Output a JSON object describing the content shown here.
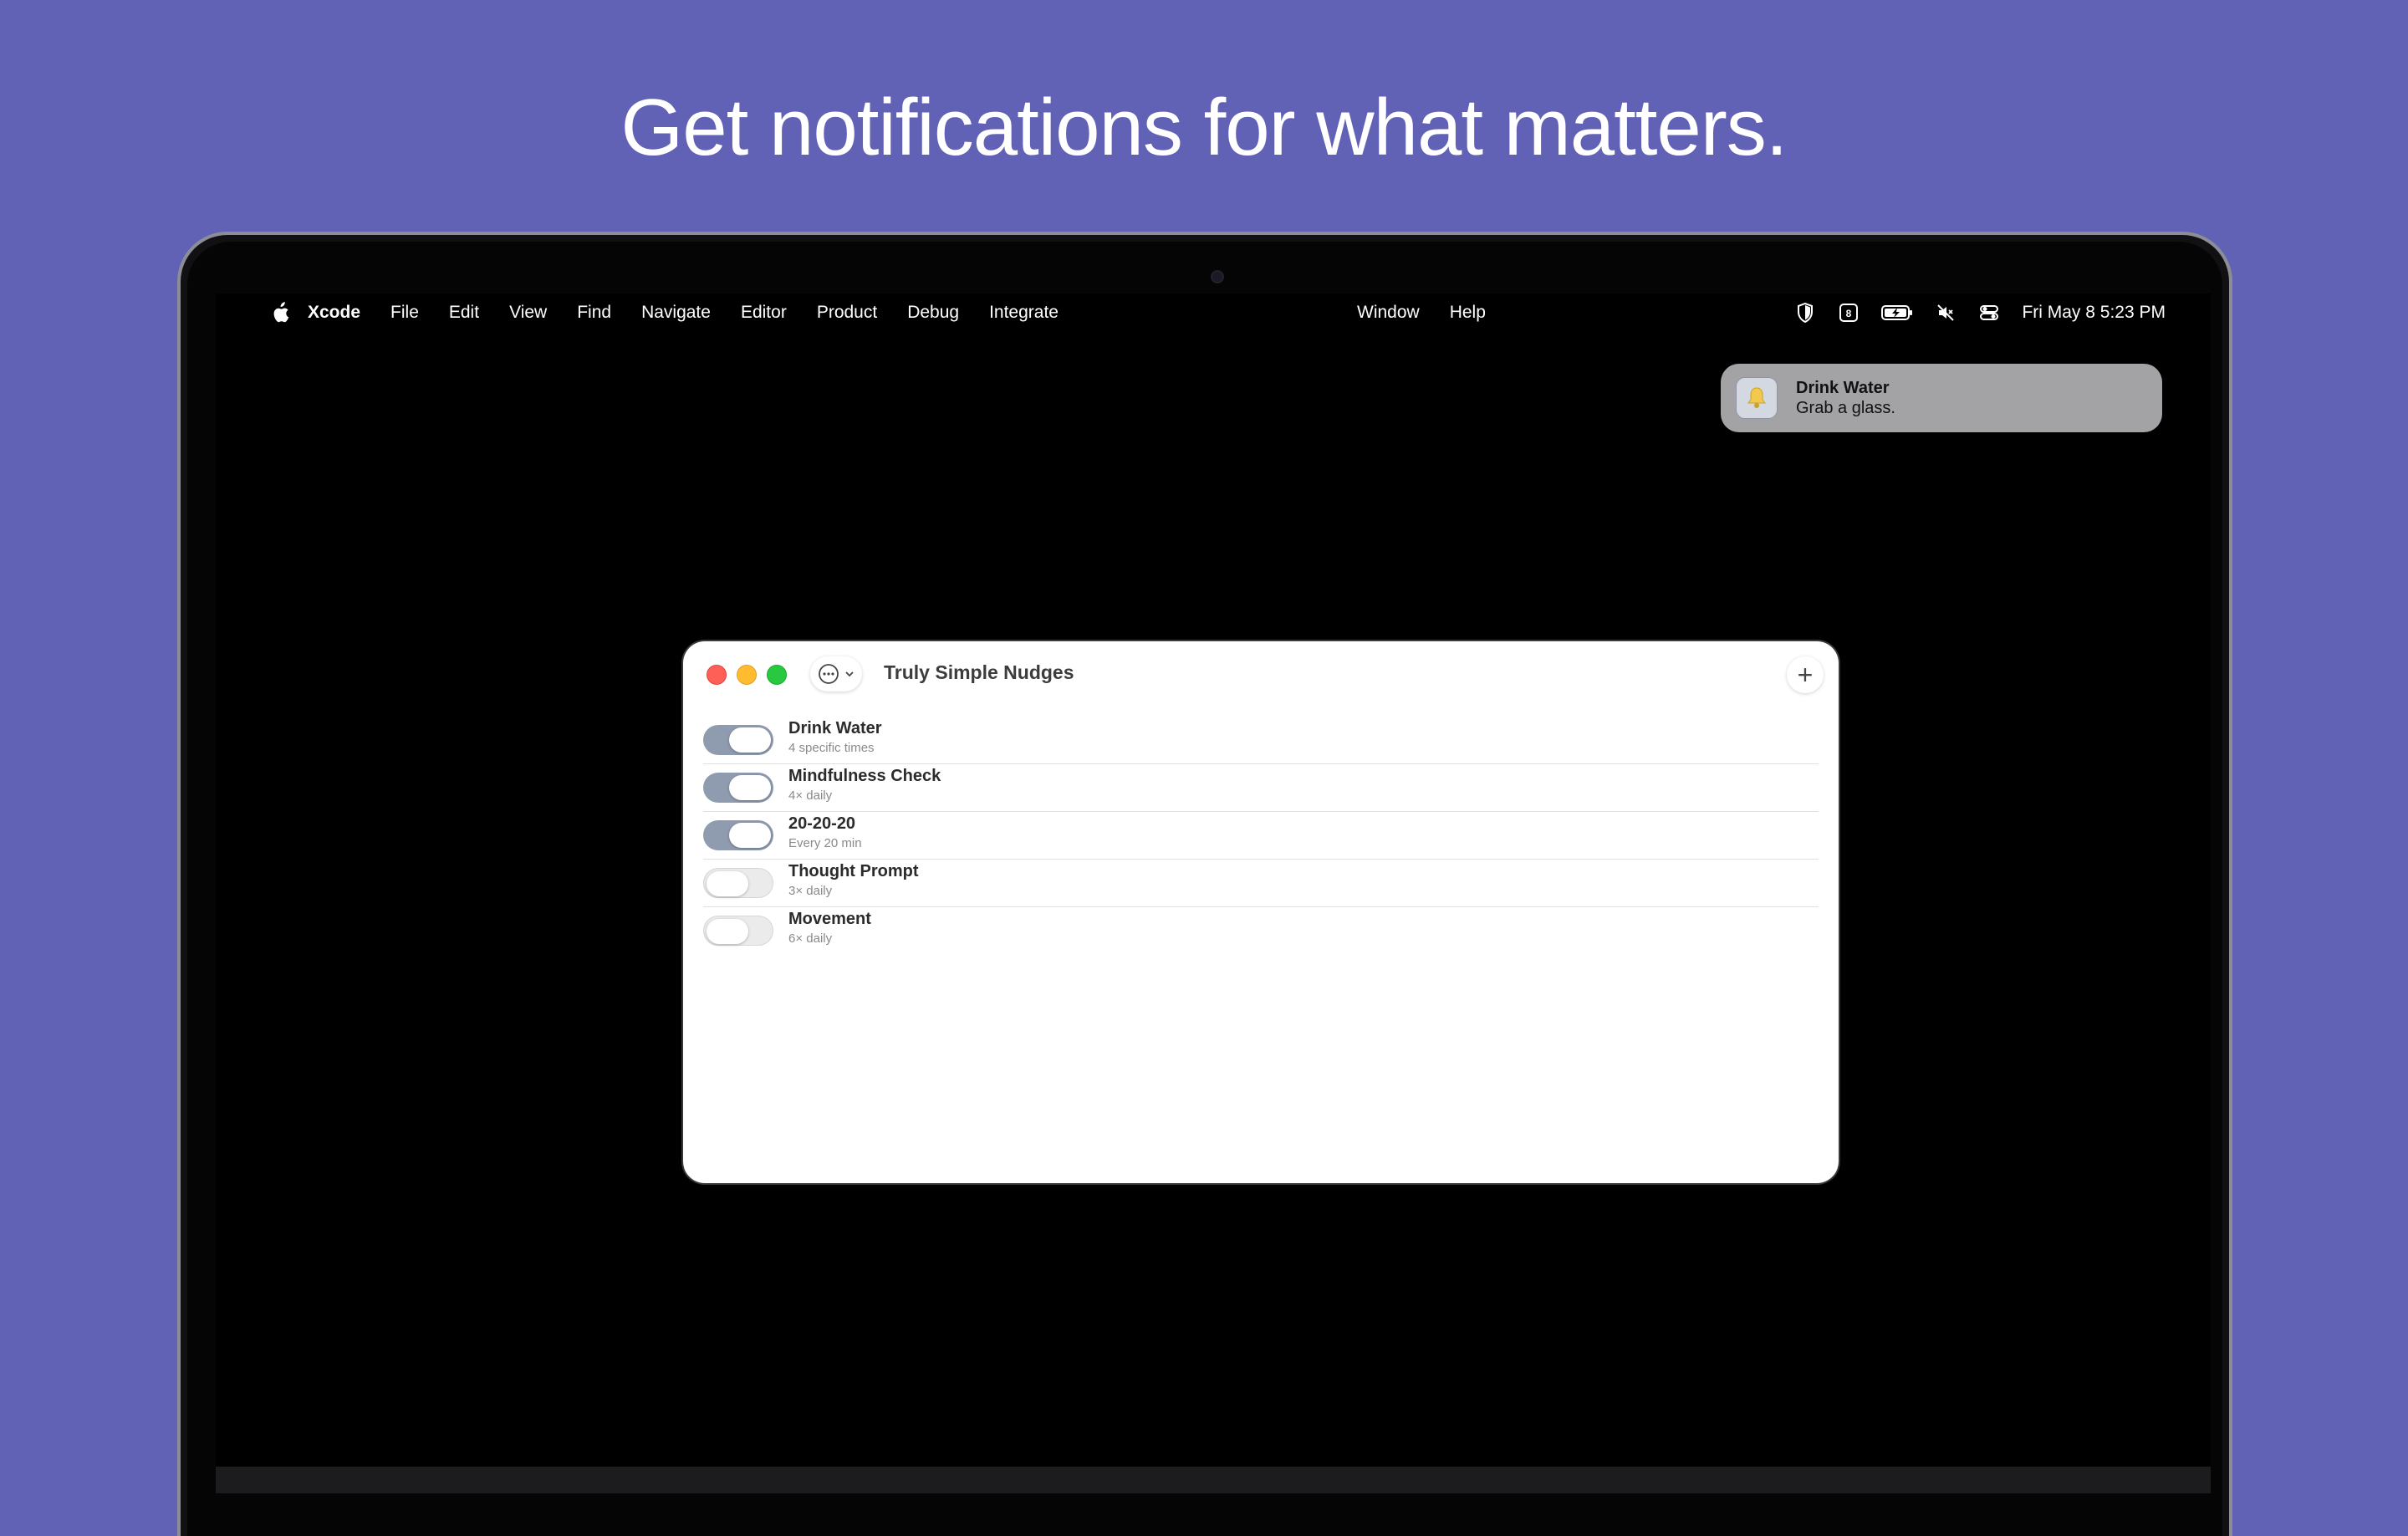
{
  "headline": "Get notifications for what matters.",
  "menubar": {
    "app_name": "Xcode",
    "items": [
      "File",
      "Edit",
      "View",
      "Find",
      "Navigate",
      "Editor",
      "Product",
      "Debug",
      "Integrate"
    ],
    "center_items": [
      "Window",
      "Help"
    ],
    "status_icons": [
      "shield-icon",
      "calendar-badge-icon",
      "battery-charging-icon",
      "mute-icon",
      "control-center-icon"
    ],
    "calendar_badge": "8",
    "clock": "Fri May 8  5:23 PM"
  },
  "notification": {
    "icon": "bell-icon",
    "title": "Drink Water",
    "body": "Grab a glass."
  },
  "window": {
    "title": "Truly Simple Nudges",
    "more_icon": "ellipsis-circle-icon",
    "add_label": "+",
    "nudges": [
      {
        "name": "Drink Water",
        "schedule": "4 specific times",
        "enabled": true
      },
      {
        "name": "Mindfulness Check",
        "schedule": "4× daily",
        "enabled": true
      },
      {
        "name": "20-20-20",
        "schedule": "Every 20 min",
        "enabled": true
      },
      {
        "name": "Thought Prompt",
        "schedule": "3× daily",
        "enabled": false
      },
      {
        "name": "Movement",
        "schedule": "6× daily",
        "enabled": false
      }
    ]
  },
  "colors": {
    "background": "#6161b5",
    "toggle_on": "#8f9bae",
    "toggle_off": "#ebebeb"
  }
}
